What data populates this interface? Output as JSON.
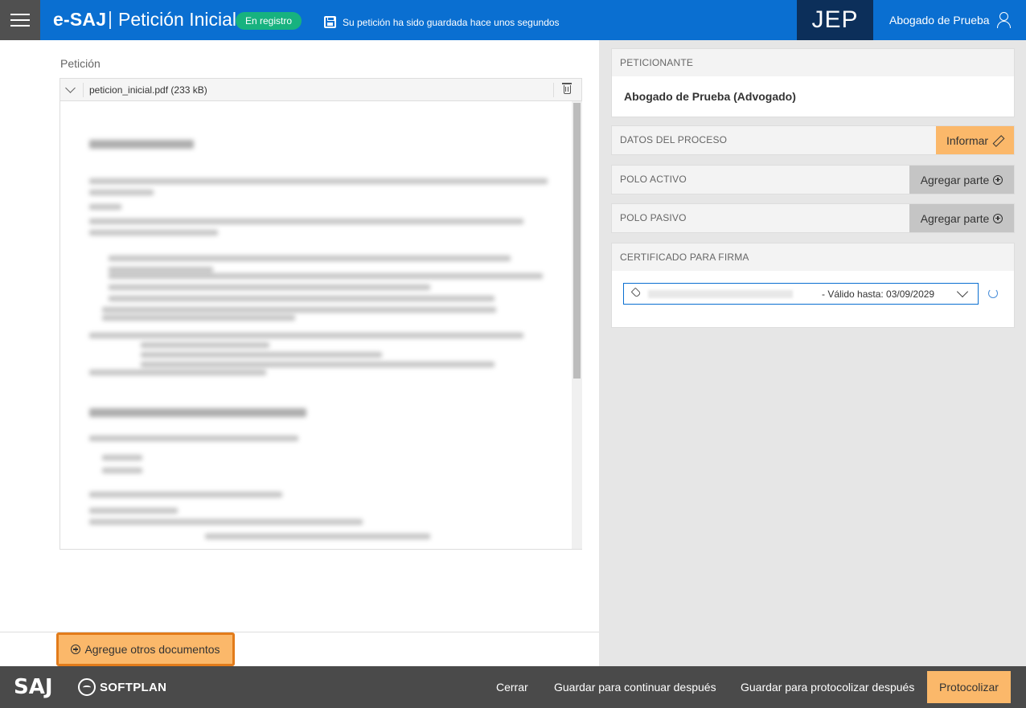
{
  "header": {
    "brand": "e-SAJ",
    "separator": "|",
    "title": "Petición Inicial",
    "status_badge": "En registro",
    "save_info": "Su petición ha sido guardada hace unos segundos",
    "org": "JEP",
    "user_name": "Abogado de Prueba",
    "colors": {
      "bar": "#0a6fd1",
      "org_block": "#0c2f5a",
      "badge": "#17b27f"
    }
  },
  "main": {
    "section_label": "Petición",
    "document": {
      "file_name": "peticion_inicial.pdf (233 kB)"
    },
    "add_documents_label": "Agregue otros documentos"
  },
  "sidebar": {
    "petitioner": {
      "title": "PETICIONANTE",
      "name": "Abogado de Prueba (Advogado)"
    },
    "process_data": {
      "title": "DATOS DEL PROCESO",
      "button": "Informar"
    },
    "active_pole": {
      "title": "POLO ACTIVO",
      "button": "Agregar parte"
    },
    "passive_pole": {
      "title": "POLO PASIVO",
      "button": "Agregar parte"
    },
    "certificate": {
      "title": "CERTIFICADO PARA FIRMA",
      "selected_suffix": "- Válido hasta: 03/09/2029"
    }
  },
  "footer": {
    "logo_saj": "SAJ",
    "logo_softplan": "SOFTPLAN",
    "close": "Cerrar",
    "save_continue": "Guardar para continuar después",
    "save_protocol": "Guardar para protocolizar después",
    "protocolize": "Protocolizar",
    "colors": {
      "bar": "#4a4a4a",
      "primary_button": "#fbb86a"
    }
  }
}
